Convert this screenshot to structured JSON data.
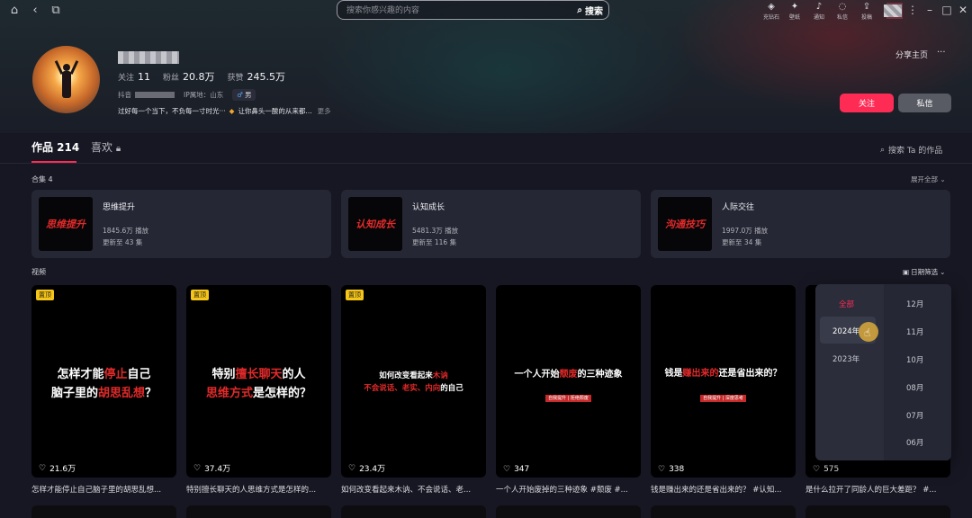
{
  "topbar": {
    "search_placeholder": "搜索你感兴趣的内容",
    "search_label": "搜索",
    "tools": [
      {
        "icon": "diamond-icon",
        "glyph": "◈",
        "label": "充钻石"
      },
      {
        "icon": "wallpaper-icon",
        "glyph": "✦",
        "label": "壁纸"
      },
      {
        "icon": "bell-icon",
        "glyph": "♪",
        "label": "通知"
      },
      {
        "icon": "chat-icon",
        "glyph": "◌",
        "label": "私信"
      },
      {
        "icon": "upload-icon",
        "glyph": "⇪",
        "label": "投稿"
      }
    ]
  },
  "profile": {
    "stats": [
      {
        "label": "关注",
        "value": "11"
      },
      {
        "label": "粉丝",
        "value": "20.8万"
      },
      {
        "label": "获赞",
        "value": "245.5万"
      }
    ],
    "id_label": "抖音",
    "ip_location": "IP属地：山东",
    "gender": "男",
    "bio_1": "过好每一个当下，不负每一寸时光···",
    "bio_2": "让你鼻头一酸的从来都...",
    "bio_more": "更多",
    "share_label": "分享主页",
    "more_label": "···",
    "follow_label": "关注",
    "message_label": "私信"
  },
  "tabs": {
    "works": "作品 214",
    "likes": "喜欢",
    "search_works": "搜索 Ta 的作品"
  },
  "collections": {
    "label": "合集 4",
    "expand_label": "展开全部",
    "items": [
      {
        "cover": "思维提升",
        "title": "思维提升",
        "plays": "1845.6万 播放",
        "update": "更新至 43 集"
      },
      {
        "cover": "认知成长",
        "title": "认知成长",
        "plays": "5481.3万 播放",
        "update": "更新至 116 集"
      },
      {
        "cover": "沟通技巧",
        "title": "人际交往",
        "plays": "1997.0万 播放",
        "update": "更新至 34 集"
      }
    ]
  },
  "videos": {
    "label": "视频",
    "date_filter": "日期筛选",
    "items": [
      {
        "pinned": "置顶",
        "cover_a": "怎样才能",
        "cover_a_red": "停止",
        "cover_a2": "自己",
        "cover_b": "脑子里的",
        "cover_b_red": "胡思乱想",
        "cover_b2": "？",
        "sub": "",
        "likes": "21.6万",
        "caption": "怎样才能停止自己脑子里的胡思乱想..."
      },
      {
        "pinned": "置顶",
        "cover_a": "特别",
        "cover_a_red": "擅长聊天",
        "cover_a2": "的人",
        "cover_b": "",
        "cover_b_red": "思维方式",
        "cover_b2": "是怎样的？",
        "sub": "",
        "likes": "37.4万",
        "caption": "特别擅长聊天的人思维方式是怎样的..."
      },
      {
        "pinned": "置顶",
        "cover_a": "如何改变看起来",
        "cover_a_red": "木讷",
        "cover_a2": "",
        "cover_b": "",
        "cover_b_red": "不会说话、老实、内向",
        "cover_b2": "的自己",
        "sub": "",
        "likes": "23.4万",
        "caption": "如何改变看起来木讷、不会说话、老..."
      },
      {
        "pinned": "",
        "cover_a": "一个人开始",
        "cover_a_red": "颓废",
        "cover_a2": "的三种迹象",
        "cover_b": "",
        "cover_b_red": "",
        "cover_b2": "",
        "sub": "自我提升 | 拒绝颓废",
        "likes": "347",
        "caption": "一个人开始废掉的三种迹象 #颓废 #..."
      },
      {
        "pinned": "",
        "cover_a": "钱是",
        "cover_a_red": "赚出来的",
        "cover_a2": "还是省出来的？",
        "cover_b": "",
        "cover_b_red": "",
        "cover_b2": "",
        "sub": "自我提升 | 深度思考",
        "likes": "338",
        "caption": "钱是赚出来的还是省出来的？ #认知..."
      },
      {
        "pinned": "",
        "cover_a": "",
        "cover_a_red": "",
        "cover_a2": "",
        "cover_b": "",
        "cover_b_red": "",
        "cover_b2": "",
        "sub": "",
        "likes": "575",
        "caption": "是什么拉开了同龄人的巨大差距？ #..."
      }
    ]
  },
  "date_dropdown": {
    "years": [
      "全部",
      "2024年",
      "2023年"
    ],
    "months": [
      "12月",
      "11月",
      "10月",
      "08月",
      "07月",
      "06月"
    ]
  },
  "colors": {
    "accent": "#fe2c55",
    "pin": "#f5c518",
    "cover_red": "#e32a2a"
  }
}
